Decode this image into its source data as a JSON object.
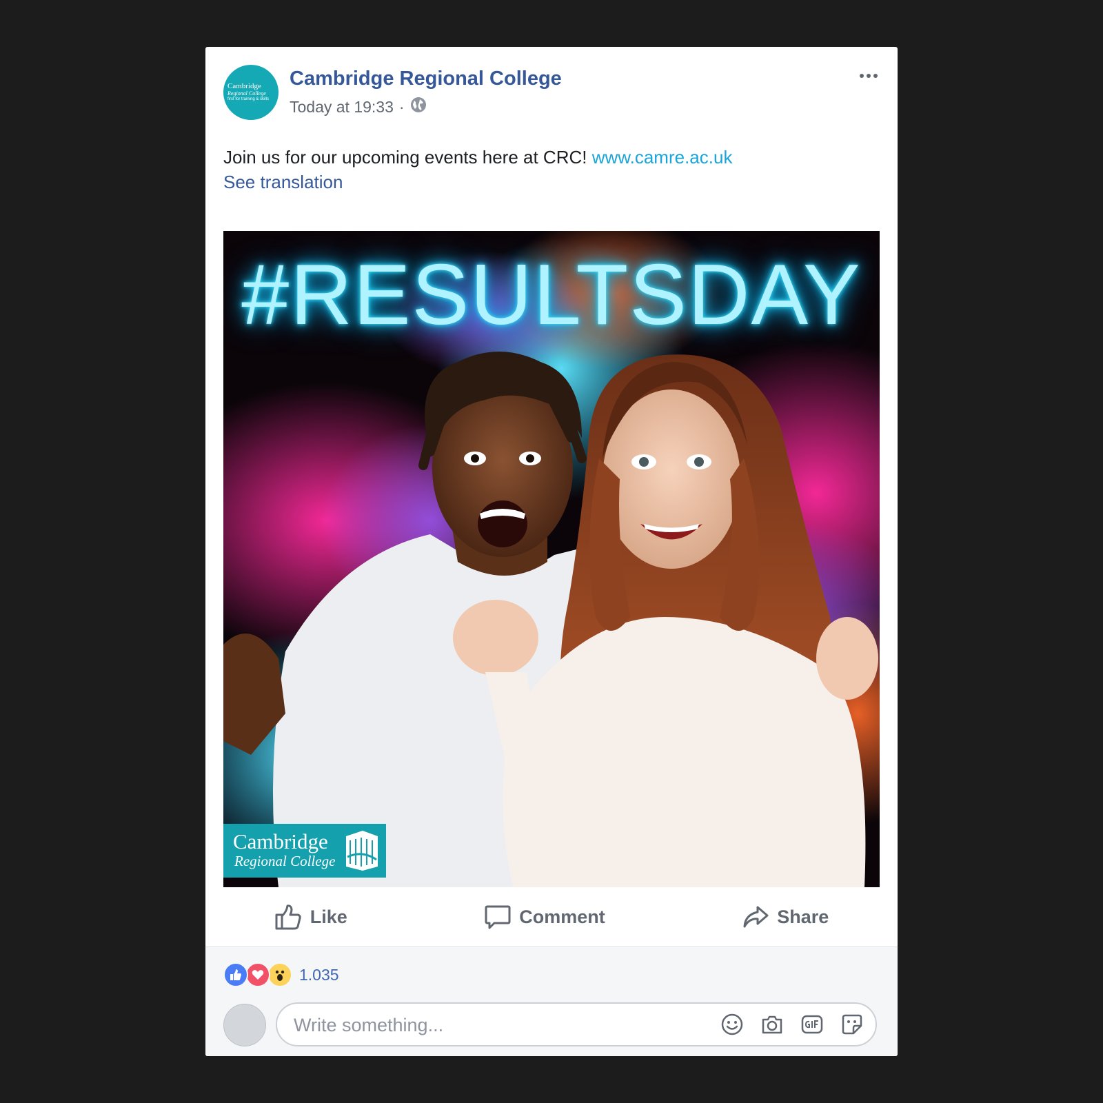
{
  "post": {
    "page_name": "Cambridge Regional College",
    "timestamp": "Today at 19:33",
    "separator": "·",
    "body_text": "Join us for our upcoming events here at CRC!",
    "link_text": "www.camre.ac.uk",
    "see_translation": "See translation",
    "avatar_logo": {
      "line1": "Cambridge",
      "line2": "Regional College",
      "line3": "first for training & skills"
    }
  },
  "image": {
    "hashtag": "#RESULTSDAY",
    "logo_line1": "Cambridge",
    "logo_line2": "Regional College"
  },
  "actions": {
    "like": "Like",
    "comment": "Comment",
    "share": "Share"
  },
  "reactions": {
    "icons": [
      "like-icon",
      "love-icon",
      "wow-icon"
    ],
    "count": "1.035"
  },
  "composer": {
    "placeholder": "Write something...",
    "icons": [
      "emoji-icon",
      "camera-icon",
      "gif-icon",
      "sticker-icon"
    ]
  },
  "colors": {
    "page_background": "#1c1c1c",
    "link_blue": "#365899",
    "url_blue": "#1aa4d8",
    "brand_teal": "#14a0ad",
    "neon_cyan": "#3ee0ff"
  }
}
